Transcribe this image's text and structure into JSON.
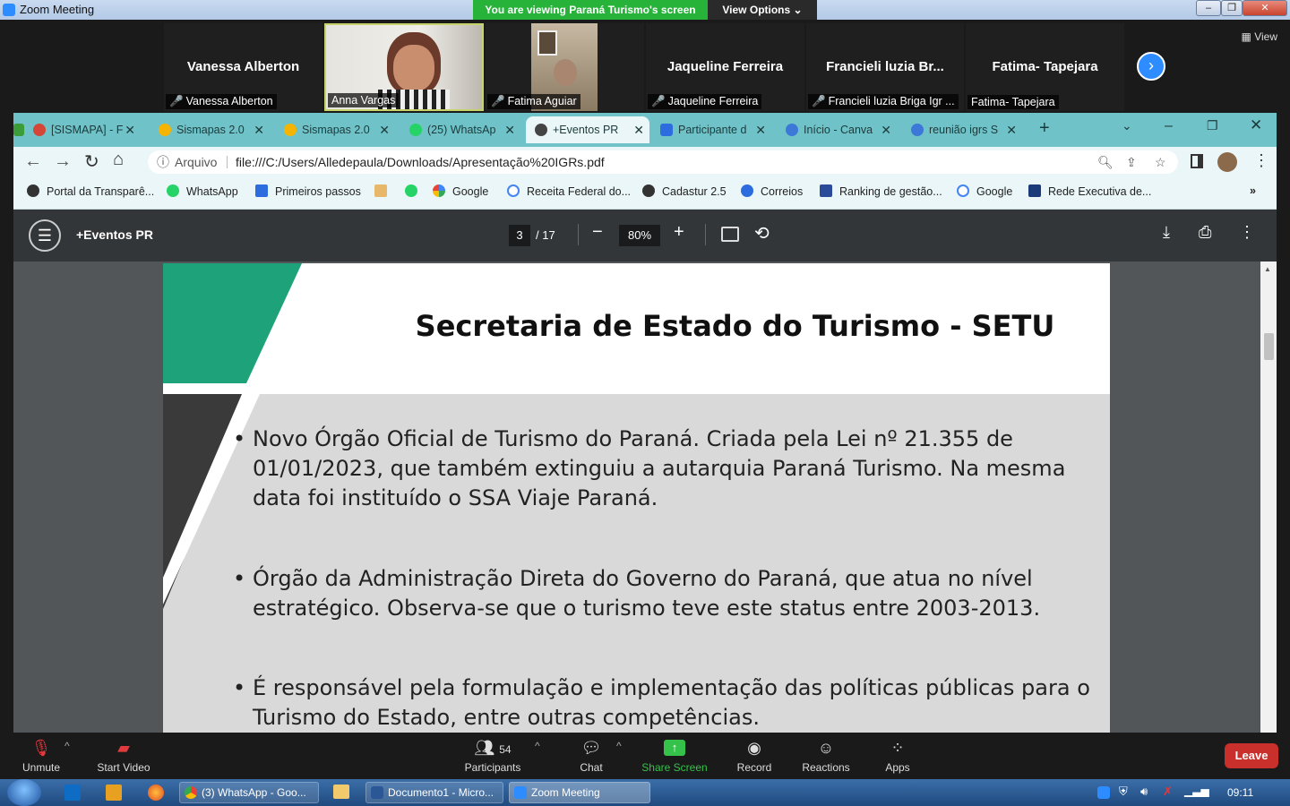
{
  "zoom": {
    "window_title": "Zoom Meeting",
    "viewing_banner": "You are viewing Paraná Turismo's screen",
    "view_options": "View Options",
    "view_label": "View",
    "participants": [
      {
        "display": "Vanessa Alberton",
        "label": "Vanessa Alberton",
        "muted": true,
        "video": false
      },
      {
        "display": "",
        "label": "Anna Vargas",
        "muted": false,
        "video": true
      },
      {
        "display": "",
        "label": "Fatima Aguiar",
        "muted": true,
        "video": true
      },
      {
        "display": "Jaqueline Ferreira",
        "label": "Jaqueline Ferreira",
        "muted": true,
        "video": false
      },
      {
        "display": "Francieli  luzia Br...",
        "label": "Francieli luzia Briga Igr ...",
        "muted": true,
        "video": false
      },
      {
        "display": "Fatima- Tapejara",
        "label": "Fatima- Tapejara",
        "muted": false,
        "video": false
      }
    ],
    "controls": {
      "unmute": "Unmute",
      "start_video": "Start Video",
      "participants": "Participants",
      "participants_count": "54",
      "chat": "Chat",
      "share_screen": "Share Screen",
      "record": "Record",
      "reactions": "Reactions",
      "apps": "Apps",
      "leave": "Leave"
    }
  },
  "browser": {
    "tabs": [
      {
        "label": "[SISMAPA] - F",
        "color": "#d44638"
      },
      {
        "label": "Sismapas 2.0",
        "color": "#f4b400"
      },
      {
        "label": "Sismapas 2.0",
        "color": "#f4b400"
      },
      {
        "label": "(25) WhatsAp",
        "color": "#25d366"
      },
      {
        "label": "+Eventos PR",
        "color": "#444444",
        "active": true
      },
      {
        "label": "Participante d",
        "color": "#2d6cdf"
      },
      {
        "label": "Início - Canva",
        "color": "#3c78d8"
      },
      {
        "label": "reunião igrs S",
        "color": "#3c78d8"
      }
    ],
    "address_prefix": "Arquivo",
    "url": "file:///C:/Users/Alledepaula/Downloads/Apresentação%20IGRs.pdf",
    "bookmarks": [
      "Portal da Transparê...",
      "WhatsApp",
      "Primeiros passos",
      "Google",
      "Receita Federal do...",
      "Cadastur 2.5",
      "Correios",
      "Ranking de gestão...",
      "Google",
      "Rede Executiva de..."
    ]
  },
  "pdf": {
    "title": "+Eventos PR",
    "page_current": "3",
    "page_total": "/ 17",
    "zoom": "80%"
  },
  "slide": {
    "heading": "Secretaria de Estado do Turismo - SETU",
    "bullets": [
      "Novo Órgão Oficial de Turismo do Paraná. Criada pela Lei nº 21.355 de 01/01/2023, que também extinguiu a autarquia Paraná Turismo. Na mesma data foi instituído o SSA Viaje Paraná.",
      "Órgão da Administração Direta do Governo do Paraná, que atua no nível estratégico. Observa-se que o turismo teve este status entre 2003-2013.",
      "É  responsável pela formulação e implementação das políticas públicas para o Turismo do Estado, entre outras competências."
    ]
  },
  "taskbar": {
    "items": [
      "(3) WhatsApp - Goo...",
      "Documento1 - Micro...",
      "Zoom Meeting"
    ],
    "clock": "09:11"
  }
}
